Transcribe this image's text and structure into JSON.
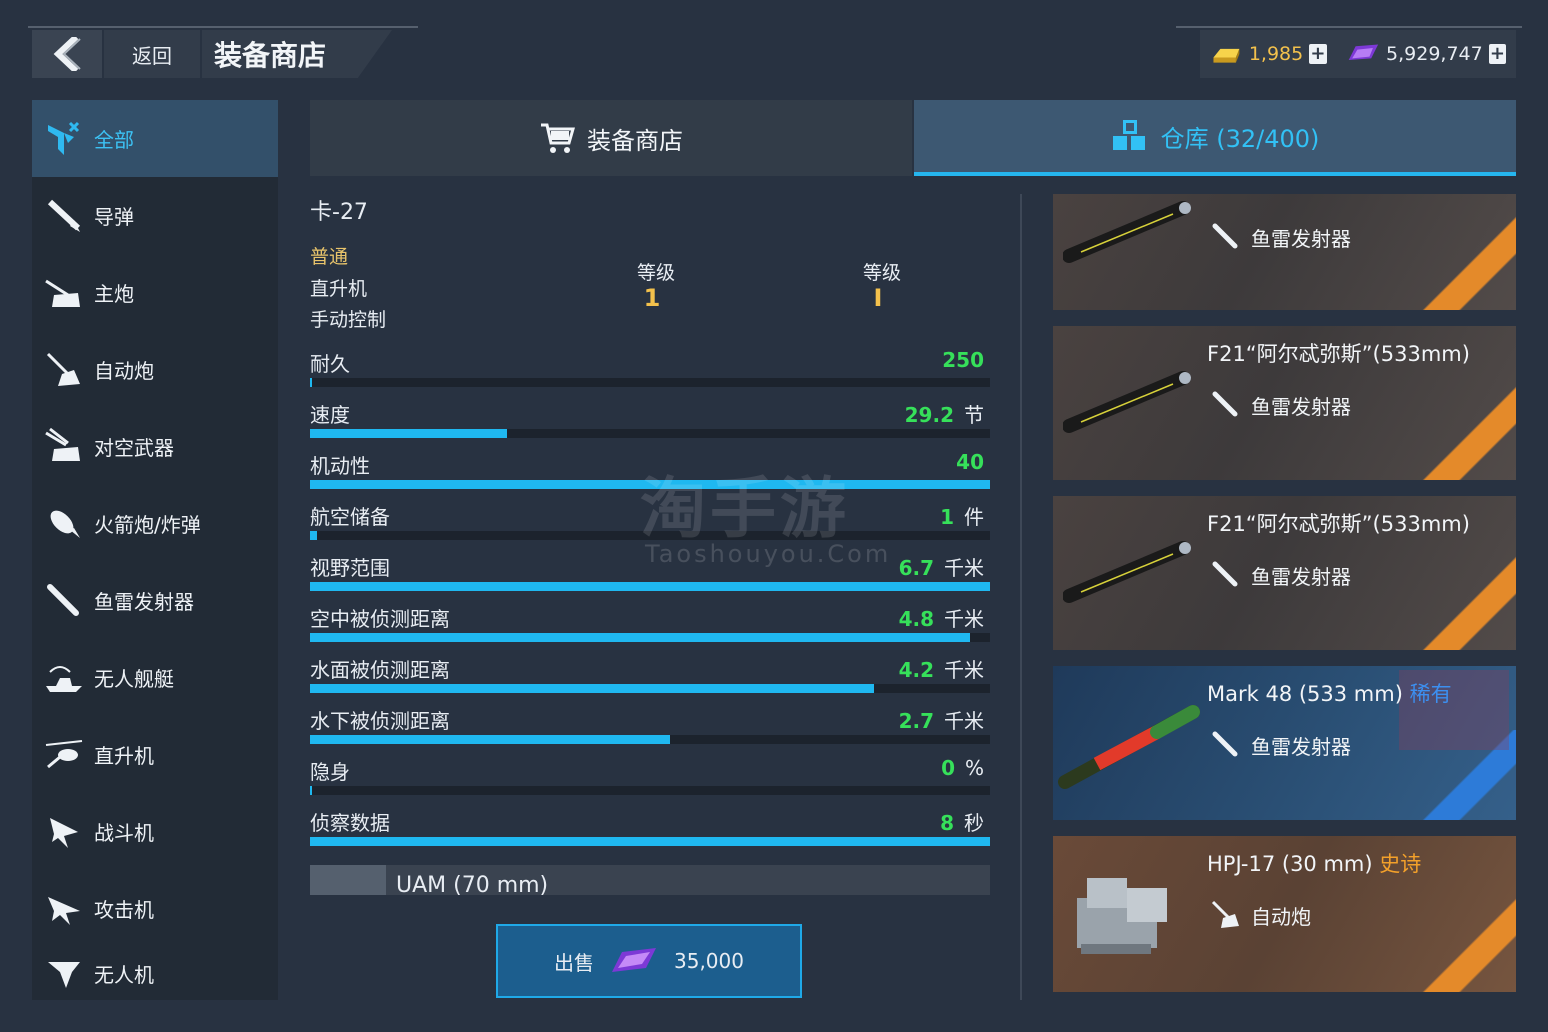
{
  "header": {
    "back_label": "返回",
    "title": "装备商店",
    "gold": "1,985",
    "gems": "5,929,747"
  },
  "sidebar": {
    "items": [
      {
        "label": "全部",
        "icon": "all-filter-icon",
        "active": true
      },
      {
        "label": "导弹",
        "icon": "missile-icon"
      },
      {
        "label": "主炮",
        "icon": "main-gun-icon"
      },
      {
        "label": "自动炮",
        "icon": "autocannon-icon"
      },
      {
        "label": "对空武器",
        "icon": "anti-air-icon"
      },
      {
        "label": "火箭炮/炸弹",
        "icon": "rocket-bomb-icon"
      },
      {
        "label": "鱼雷发射器",
        "icon": "torpedo-icon"
      },
      {
        "label": "无人舰艇",
        "icon": "drone-boat-icon"
      },
      {
        "label": "直升机",
        "icon": "helicopter-icon"
      },
      {
        "label": "战斗机",
        "icon": "fighter-icon"
      },
      {
        "label": "攻击机",
        "icon": "attacker-icon"
      },
      {
        "label": "无人机",
        "icon": "drone-icon"
      }
    ]
  },
  "tabs": {
    "shop": "装备商店",
    "warehouse": "仓库 (32/400)"
  },
  "detail": {
    "name": "卡-27",
    "rarity": "普通",
    "category": "直升机",
    "control": "手动控制",
    "level_label_1": "等级",
    "level_value_1": "1",
    "level_label_2": "等级",
    "level_value_2": "I",
    "stats": [
      {
        "label": "耐久",
        "value": "250",
        "unit": "",
        "fill": 0.0
      },
      {
        "label": "速度",
        "value": "29.2",
        "unit": "节",
        "fill": 0.29
      },
      {
        "label": "机动性",
        "value": "40",
        "unit": "",
        "fill": 1.0
      },
      {
        "label": "航空储备",
        "value": "1",
        "unit": "件",
        "fill": 0.01
      },
      {
        "label": "视野范围",
        "value": "6.7",
        "unit": "千米",
        "fill": 1.0
      },
      {
        "label": "空中被侦测距离",
        "value": "4.8",
        "unit": "千米",
        "fill": 0.97
      },
      {
        "label": "水面被侦测距离",
        "value": "4.2",
        "unit": "千米",
        "fill": 0.83
      },
      {
        "label": "水下被侦测距离",
        "value": "2.7",
        "unit": "千米",
        "fill": 0.53
      },
      {
        "label": "隐身",
        "value": "0",
        "unit": "%",
        "fill": 0.0
      },
      {
        "label": "侦察数据",
        "value": "8",
        "unit": "秒",
        "fill": 1.0
      }
    ],
    "next_item": "UAM (70 mm)"
  },
  "sell": {
    "label": "出售",
    "price": "35,000"
  },
  "cards": [
    {
      "title": "",
      "rarity": "",
      "type": "鱼雷发射器"
    },
    {
      "title": "F21“阿尔忒弥斯”(533mm)",
      "rarity": "",
      "type": "鱼雷发射器"
    },
    {
      "title": "F21“阿尔忒弥斯”(533mm)",
      "rarity": "",
      "type": "鱼雷发射器"
    },
    {
      "title": "Mark 48 (533 mm)",
      "rarity": "稀有",
      "type": "鱼雷发射器"
    },
    {
      "title": "HPJ-17 (30 mm)",
      "rarity": "史诗",
      "type": "自动炮"
    }
  ],
  "watermark": {
    "main": "淘手游",
    "sub": "Taoshouyou.Com"
  }
}
